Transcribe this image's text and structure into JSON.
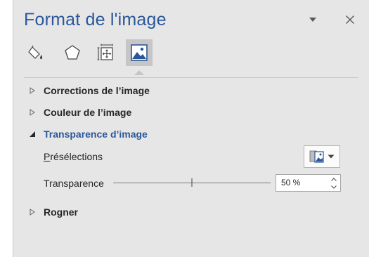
{
  "panel": {
    "title": "Format de l'image",
    "dropdown_icon": "caret-down-icon",
    "close_icon": "close-icon"
  },
  "tabs": [
    {
      "name": "fill-line",
      "icon": "paint-bucket-icon",
      "active": false
    },
    {
      "name": "effects",
      "icon": "pentagon-icon",
      "active": false
    },
    {
      "name": "size-properties",
      "icon": "size-layout-icon",
      "active": false
    },
    {
      "name": "picture",
      "icon": "picture-icon",
      "active": true
    }
  ],
  "sections": {
    "corrections": {
      "label": "Corrections de l’image",
      "expanded": false
    },
    "color": {
      "label": "Couleur de l’image",
      "expanded": false
    },
    "transparency": {
      "label": "Transparence d’image",
      "expanded": true,
      "presets_label_accel": "P",
      "presets_label_rest": "résélections",
      "transparency_label": "Transparence",
      "transparency_value_text": "50 %",
      "transparency_percent": 50
    },
    "crop": {
      "label": "Rogner",
      "expanded": false
    }
  },
  "colors": {
    "accent": "#2b579a",
    "panel_bg": "#e6e6e6",
    "active_tab_bg": "#c6c6c6",
    "text": "#262626"
  }
}
